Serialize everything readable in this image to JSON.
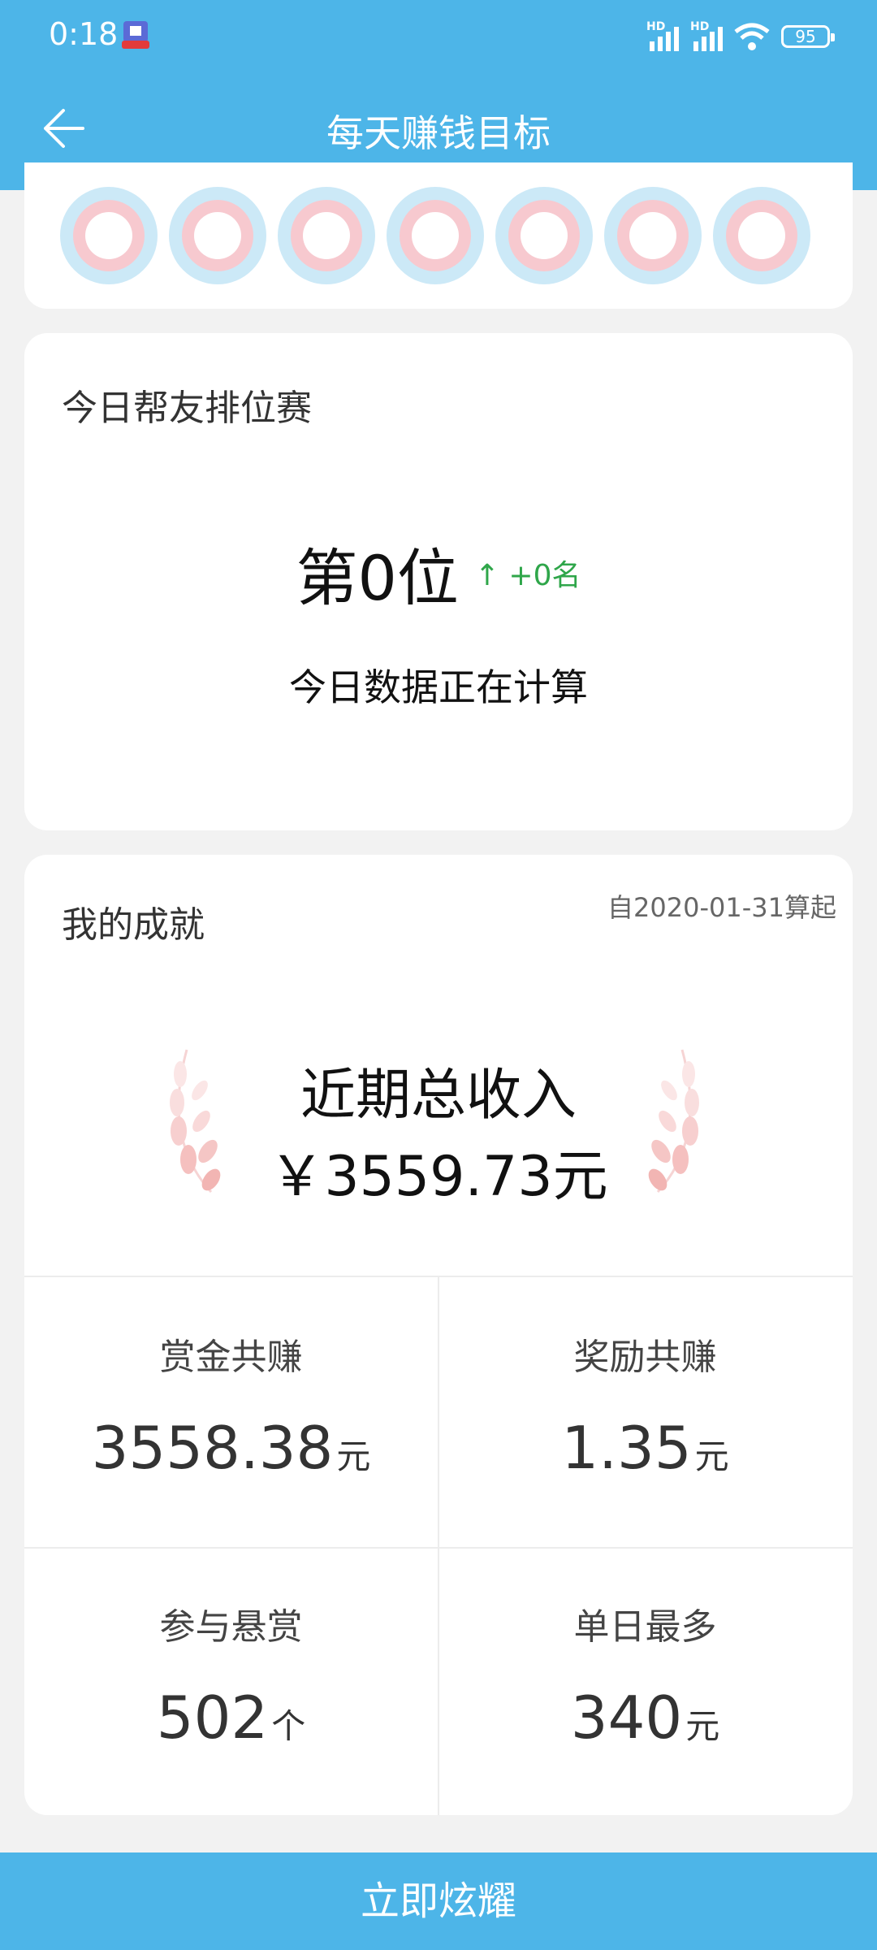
{
  "status_bar": {
    "time": "0:18",
    "battery": "95",
    "hd": "HD"
  },
  "header": {
    "title": "每天赚钱目标"
  },
  "ranking": {
    "title": "今日帮友排位赛",
    "rank_text": "第0位",
    "delta_text": "↑ +0名",
    "status": "今日数据正在计算"
  },
  "achievements": {
    "title": "我的成就",
    "since": "自2020-01-31算起",
    "total_label": "近期总收入",
    "total_value": "￥3559.73元",
    "stats": [
      {
        "label": "赏金共赚",
        "value": "3558.38",
        "unit": "元"
      },
      {
        "label": "奖励共赚",
        "value": "1.35",
        "unit": "元"
      },
      {
        "label": "参与悬赏",
        "value": "502",
        "unit": "个"
      },
      {
        "label": "单日最多",
        "value": "340",
        "unit": "元"
      }
    ]
  },
  "footer": {
    "button_label": "立即炫耀"
  },
  "colors": {
    "primary": "#4db5e8",
    "up_green": "#2fa64a"
  }
}
